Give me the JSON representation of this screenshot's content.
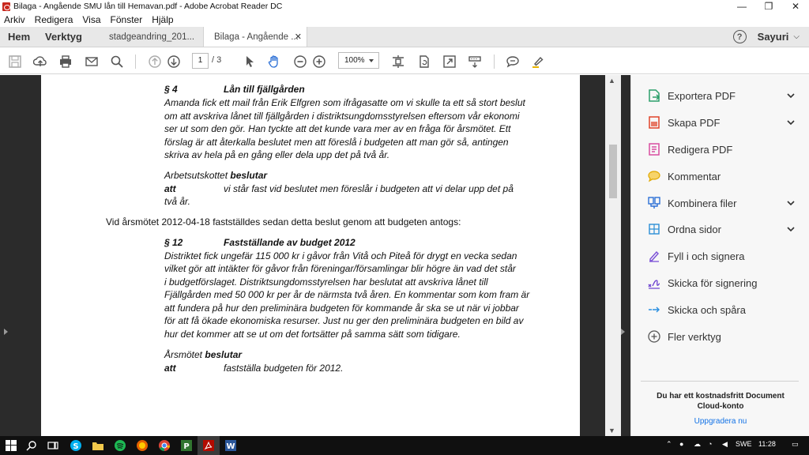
{
  "window": {
    "title": "Bilaga - Angående SMU lån till Hemavan.pdf - Adobe Acrobat Reader DC",
    "minimize": "—",
    "maximize": "❐",
    "close": "✕"
  },
  "menu": [
    "Arkiv",
    "Redigera",
    "Visa",
    "Fönster",
    "Hjälp"
  ],
  "tabs": {
    "home": "Hem",
    "tools": "Verktyg",
    "doc1": "stadgeandring_201...",
    "doc2": "Bilaga - Angående ...",
    "close": "✕",
    "help": "?",
    "user": "Sayuri"
  },
  "toolbar": {
    "page_current": "1",
    "page_total": "/ 3",
    "zoom": "100%"
  },
  "document": {
    "s4_num": "§ 4",
    "s4_title": "Lån till fjällgården",
    "s4_lines": [
      "Amanda fick ett mail från Erik Elfgren som ifrågasatte om vi skulle ta ett så stort beslut",
      "om att avskriva lånet till fjällgården i distriktsungdomsstyrelsen eftersom vår ekonomi",
      "ser ut som den gör. Han tyckte att det kunde vara mer av en fråga för årsmötet. Ett",
      "förslag är att återkalla beslutet men att föreslå i budgeten att man gör så, antingen",
      "skriva av hela på en gång eller dela upp det på två år."
    ],
    "s4_decision_prefix": "Arbetsutskottet ",
    "s4_decision_word": "beslutar",
    "s4_att": "att",
    "s4_att_text": "vi står fast vid beslutet men föreslår i budgeten att vi delar upp det på",
    "s4_att_text2": "två år.",
    "middle_line": "Vid årsmötet 2012-04-18 fastställdes sedan detta beslut genom att budgeten antogs:",
    "s12_num": "§ 12",
    "s12_title": "Fastställande av budget 2012",
    "s12_lines": [
      "Distriktet fick ungefär 115 000 kr i gåvor från Vitå och Piteå för drygt en vecka sedan",
      "vilket gör att intäkter för gåvor från föreningar/församlingar blir högre än vad det står",
      "i budgetförslaget. Distriktsungdomsstyrelsen har beslutat att avskriva lånet till",
      "Fjällgården med 50 000 kr per år de närmsta två åren. En kommentar som kom fram är",
      "att fundera på hur den preliminära budgeten för kommande år ska se ut när vi jobbar",
      "för att få ökade ekonomiska resurser. Just nu ger den preliminära budgeten en bild av",
      "hur det kommer att se ut om det fortsätter på samma sätt som tidigare."
    ],
    "s12_decision_prefix": "Årsmötet ",
    "s12_decision_word": "beslutar",
    "s12_att": "att",
    "s12_att_text": "fastställa budgeten för 2012."
  },
  "right_pane": {
    "tools": [
      {
        "label": "Exportera PDF",
        "icon": "export-pdf-icon",
        "color": "#2d9f6b",
        "expandable": true
      },
      {
        "label": "Skapa PDF",
        "icon": "create-pdf-icon",
        "color": "#e0442a",
        "expandable": true
      },
      {
        "label": "Redigera PDF",
        "icon": "edit-pdf-icon",
        "color": "#d94fa0",
        "expandable": false
      },
      {
        "label": "Kommentar",
        "icon": "comment-icon",
        "color": "#f0b400",
        "expandable": false
      },
      {
        "label": "Kombinera filer",
        "icon": "combine-files-icon",
        "color": "#2c6fd6",
        "expandable": true
      },
      {
        "label": "Ordna sidor",
        "icon": "organize-pages-icon",
        "color": "#2c8fd6",
        "expandable": true
      },
      {
        "label": "Fyll i och signera",
        "icon": "fill-sign-icon",
        "color": "#7a4fd6",
        "expandable": false
      },
      {
        "label": "Skicka för signering",
        "icon": "send-for-signature-icon",
        "color": "#6a3fd0",
        "expandable": false
      },
      {
        "label": "Skicka och spåra",
        "icon": "send-track-icon",
        "color": "#2a8fe0",
        "expandable": false
      },
      {
        "label": "Fler verktyg",
        "icon": "more-tools-icon",
        "color": "#555555",
        "expandable": false
      }
    ],
    "promo_text": "Du har ett kostnadsfritt Document Cloud-konto",
    "promo_link": "Uppgradera nu"
  },
  "taskbar": {
    "language": "SWE",
    "time": "11:28"
  }
}
